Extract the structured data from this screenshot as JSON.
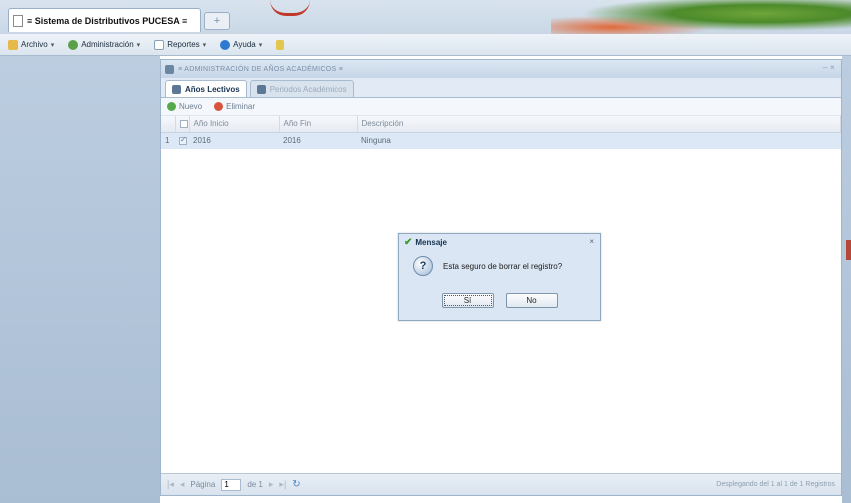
{
  "browser": {
    "tab_title": "≡ Sistema de Distributivos PUCESA ≡",
    "new_tab": "+"
  },
  "menubar": {
    "items": [
      {
        "label": "Archivo",
        "icon": "folder-icon"
      },
      {
        "label": "Administración",
        "icon": "gear-icon"
      },
      {
        "label": "Reportes",
        "icon": "report-icon"
      },
      {
        "label": "Ayuda",
        "icon": "help-icon"
      }
    ],
    "caret": "▾"
  },
  "window": {
    "title": "≡ ADMINISTRACIÓN DE AÑOS ACADÉMICOS ≡",
    "tools": "– ×",
    "tabs": [
      {
        "label": "Años Lectivos",
        "active": true
      },
      {
        "label": "Periodos Académicos",
        "active": false
      }
    ],
    "toolbar": {
      "new_label": "Nuevo",
      "delete_label": "Eliminar"
    },
    "grid": {
      "headers": [
        "Año Inicio",
        "Año Fin",
        "Descripción"
      ],
      "rows": [
        {
          "num": "1",
          "checked": true,
          "start": "2016",
          "end": "2016",
          "description": "Ninguna"
        }
      ]
    },
    "pager": {
      "page_label": "Página",
      "page_value": "1",
      "of_label": "de 1",
      "info": "Desplegando del 1 al 1 de 1 Registros"
    }
  },
  "dialog": {
    "title": "Mensaje",
    "close": "×",
    "question_icon": "?",
    "message": "Esta seguro de borrar el registro?",
    "yes_label": "Sí",
    "no_label": "No"
  }
}
